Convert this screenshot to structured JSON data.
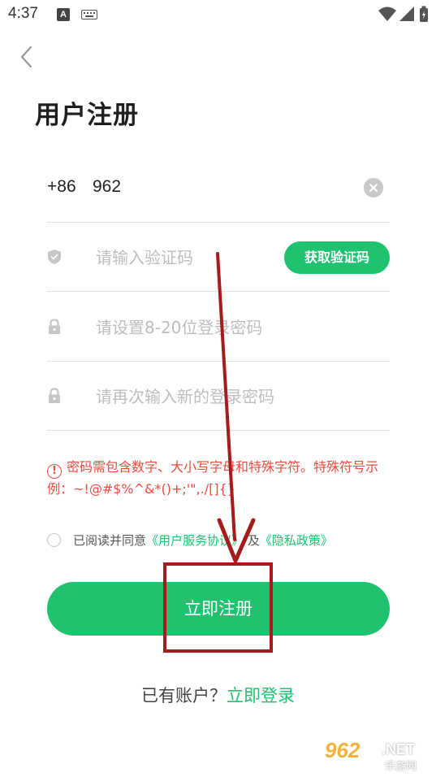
{
  "status_bar": {
    "time": "4:37",
    "notif_a": "A"
  },
  "page": {
    "title": "用户注册"
  },
  "phone": {
    "prefix": "+86",
    "value": "962"
  },
  "code": {
    "placeholder": "请输入验证码",
    "button_label": "获取验证码"
  },
  "password": {
    "placeholder": "请设置8-20位登录密码"
  },
  "password_confirm": {
    "placeholder": "请再次输入新的登录密码"
  },
  "warning": {
    "icon": "!",
    "text": "密码需包含数字、大小写字母和特殊字符。特殊符号示例：~!@#$%^&*()+;'\",./[]{}"
  },
  "agreement": {
    "prefix": "已阅读并同意",
    "service_link": "《用户服务协议》",
    "joiner": "及",
    "privacy_link": "《隐私政策》"
  },
  "register": {
    "button_label": "立即注册"
  },
  "login": {
    "prompt": "已有账户？",
    "link": "立即登录"
  },
  "watermark": {
    "number": "962",
    "domain": ".NET",
    "cn": "乐游网"
  },
  "colors": {
    "accent": "#1ec26f",
    "warning": "#ee4b3e",
    "annotation": "#a61b1b"
  },
  "icons": {
    "back": "chevron-left-icon",
    "clear": "close-circle-icon",
    "code": "shield-icon",
    "password": "lock-icon",
    "warning": "warning-circle-icon",
    "wifi": "wifi-icon",
    "signal": "signal-icon",
    "battery": "battery-icon"
  }
}
